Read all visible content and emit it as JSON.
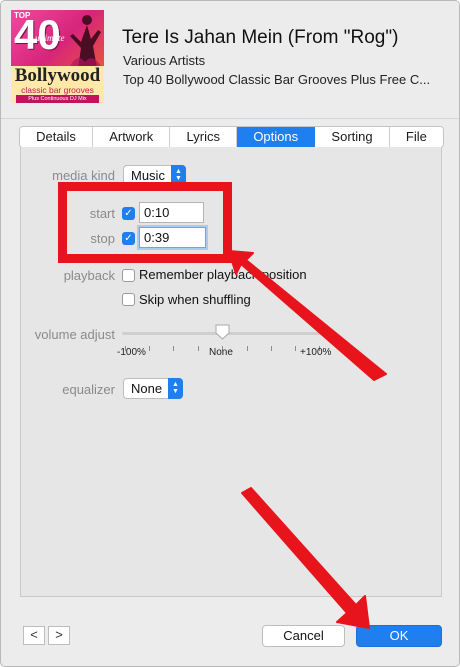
{
  "colors": {
    "accent": "#1f7ef0",
    "annotation": "#e8141c",
    "window_bg": "#ececec"
  },
  "artwork": {
    "top": "TOP",
    "number": "40",
    "ultimate": "ultimate",
    "brand": "Bollywood",
    "classic": "classic bar grooves",
    "mix": "Plus Continuous DJ Mix"
  },
  "track": {
    "title": "Tere Is Jahan Mein (From \"Rog\")",
    "artist": "Various Artists",
    "album": "Top 40 Bollywood Classic Bar Grooves Plus Free C..."
  },
  "tabs": [
    {
      "label": "Details",
      "active": false
    },
    {
      "label": "Artwork",
      "active": false
    },
    {
      "label": "Lyrics",
      "active": false
    },
    {
      "label": "Options",
      "active": true
    },
    {
      "label": "Sorting",
      "active": false
    },
    {
      "label": "File",
      "active": false
    }
  ],
  "options": {
    "media_kind": {
      "label": "media kind",
      "value": "Music"
    },
    "start": {
      "label": "start",
      "checked": true,
      "value": "0:10"
    },
    "stop": {
      "label": "stop",
      "checked": true,
      "value": "0:39"
    },
    "playback": {
      "label": "playback",
      "remember": {
        "label": "Remember playback position",
        "checked": false
      },
      "skip": {
        "label": "Skip when shuffling",
        "checked": false
      }
    },
    "volume": {
      "label": "volume adjust",
      "value_percent": 0,
      "min_label": "-100%",
      "mid_label": "None",
      "max_label": "+100%"
    },
    "equalizer": {
      "label": "equalizer",
      "value": "None"
    }
  },
  "footer": {
    "prev_icon": "chevron-left-icon",
    "next_icon": "chevron-right-icon",
    "prev": "<",
    "next": ">",
    "cancel": "Cancel",
    "ok": "OK"
  }
}
